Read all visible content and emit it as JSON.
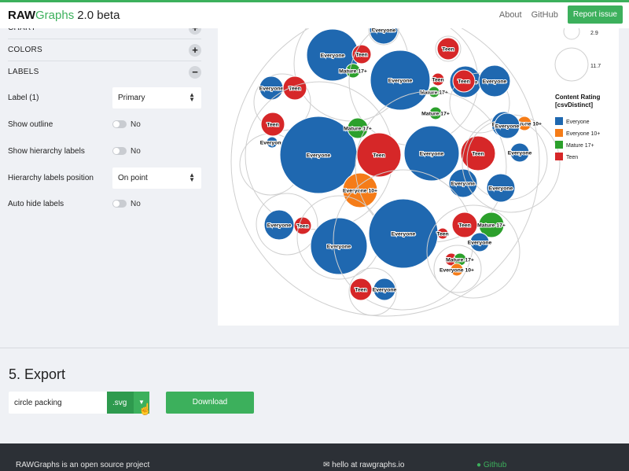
{
  "header": {
    "brand_bold": "RAW",
    "brand_green": "Graphs",
    "brand_version": "2.0 beta",
    "links": {
      "about": "About",
      "github": "GitHub",
      "report": "Report issue"
    }
  },
  "sidebar": {
    "sections": [
      {
        "label": "CHART",
        "state": "+"
      },
      {
        "label": "COLORS",
        "state": "+"
      },
      {
        "label": "LABELS",
        "state": "−"
      }
    ],
    "label1": {
      "label": "Label (1)",
      "value": "Primary"
    },
    "show_outline": {
      "label": "Show outline",
      "value": "No"
    },
    "show_hierarchy": {
      "label": "Show hierarchy labels",
      "value": "No"
    },
    "hierarchy_pos": {
      "label": "Hierarchy labels position",
      "value": "On point"
    },
    "auto_hide": {
      "label": "Auto hide labels",
      "value": "No"
    }
  },
  "chart_data": {
    "type": "circle-packing",
    "legend": {
      "size_values": [
        "2.9",
        "11.7"
      ],
      "title_line1": "Content Rating",
      "title_line2": "[csvDistinct]",
      "items": [
        {
          "label": "Everyone",
          "color": "#1f68b0"
        },
        {
          "label": "Everyone 10+",
          "color": "#f57c18"
        },
        {
          "label": "Mature 17+",
          "color": "#2ca02c"
        },
        {
          "label": "Teen",
          "color": "#d62728"
        }
      ]
    },
    "colors": {
      "Everyone": "#1f68b0",
      "Everyone 10+": "#f57c18",
      "Mature 17+": "#2ca02c",
      "Teen": "#d62728"
    },
    "groups": [
      {
        "leaves": [
          {
            "label": "Everyone",
            "cat": "Everyone"
          }
        ]
      },
      {
        "leaves": [
          {
            "label": "Everyone",
            "cat": "Everyone"
          },
          {
            "label": "Teen",
            "cat": "Teen"
          },
          {
            "label": "Mature 17+",
            "cat": "Mature 17+"
          }
        ]
      },
      {
        "leaves": [
          {
            "label": "Teen",
            "cat": "Teen"
          }
        ]
      },
      {
        "leaves": [
          {
            "label": "Everyone",
            "cat": "Everyone"
          },
          {
            "label": "Teen",
            "cat": "Teen"
          },
          {
            "label": "Mature 17+",
            "cat": "Mature 17+"
          }
        ]
      },
      {
        "leaves": [
          {
            "label": "Everyone",
            "cat": "Everyone"
          },
          {
            "label": "Teen",
            "cat": "Teen"
          }
        ]
      },
      {
        "leaves": [
          {
            "label": "Teen",
            "cat": "Teen"
          },
          {
            "label": "Everyone",
            "cat": "Everyone"
          }
        ]
      },
      {
        "leaves": [
          {
            "label": "Everyone",
            "cat": "Everyone"
          },
          {
            "label": "Teen",
            "cat": "Teen"
          },
          {
            "label": "Mature 17+",
            "cat": "Mature 17+"
          },
          {
            "label": "Everyone 10+",
            "cat": "Everyone 10+"
          }
        ]
      },
      {
        "leaves": [
          {
            "label": "Everyone",
            "cat": "Everyone"
          },
          {
            "label": "Teen",
            "cat": "Teen"
          },
          {
            "label": "Everyone",
            "cat": "Everyone"
          },
          {
            "label": "Mature 17+",
            "cat": "Mature 17+"
          },
          {
            "label": "Everyone",
            "cat": "Everyone"
          }
        ]
      },
      {
        "leaves": [
          {
            "label": "Everyone",
            "cat": "Everyone"
          },
          {
            "label": "Everyone 10+",
            "cat": "Everyone 10+"
          },
          {
            "label": "Teen",
            "cat": "Teen"
          }
        ]
      },
      {
        "leaves": [
          {
            "label": "Everyone",
            "cat": "Everyone"
          },
          {
            "label": "Teen",
            "cat": "Teen"
          }
        ]
      },
      {
        "leaves": [
          {
            "label": "Everyone",
            "cat": "Everyone"
          },
          {
            "label": "Everyone",
            "cat": "Everyone"
          },
          {
            "label": "Everyone",
            "cat": "Everyone"
          }
        ]
      },
      {
        "leaves": [
          {
            "label": "Everyone",
            "cat": "Everyone"
          },
          {
            "label": "Teen",
            "cat": "Teen"
          }
        ]
      },
      {
        "leaves": [
          {
            "label": "Everyone",
            "cat": "Everyone"
          }
        ]
      },
      {
        "leaves": [
          {
            "label": "Everyone",
            "cat": "Everyone"
          },
          {
            "label": "Teen",
            "cat": "Teen"
          }
        ]
      },
      {
        "leaves": [
          {
            "label": "Teen",
            "cat": "Teen"
          },
          {
            "label": "Mature 17+",
            "cat": "Mature 17+"
          },
          {
            "label": "Everyone",
            "cat": "Everyone"
          }
        ]
      },
      {
        "leaves": [
          {
            "label": "Teen",
            "cat": "Teen"
          },
          {
            "label": "Mature 17+",
            "cat": "Mature 17+"
          },
          {
            "label": "Everyone 10+",
            "cat": "Everyone 10+"
          }
        ]
      },
      {
        "leaves": [
          {
            "label": "Teen",
            "cat": "Teen"
          },
          {
            "label": "Everyone",
            "cat": "Everyone"
          }
        ]
      }
    ]
  },
  "export": {
    "title": "5. Export",
    "filename": "circle packing",
    "format": ".svg",
    "download": "Download"
  },
  "footer": {
    "left": "RAWGraphs is an open source project",
    "mid": "hello at rawgraphs.io",
    "right": "Github"
  }
}
